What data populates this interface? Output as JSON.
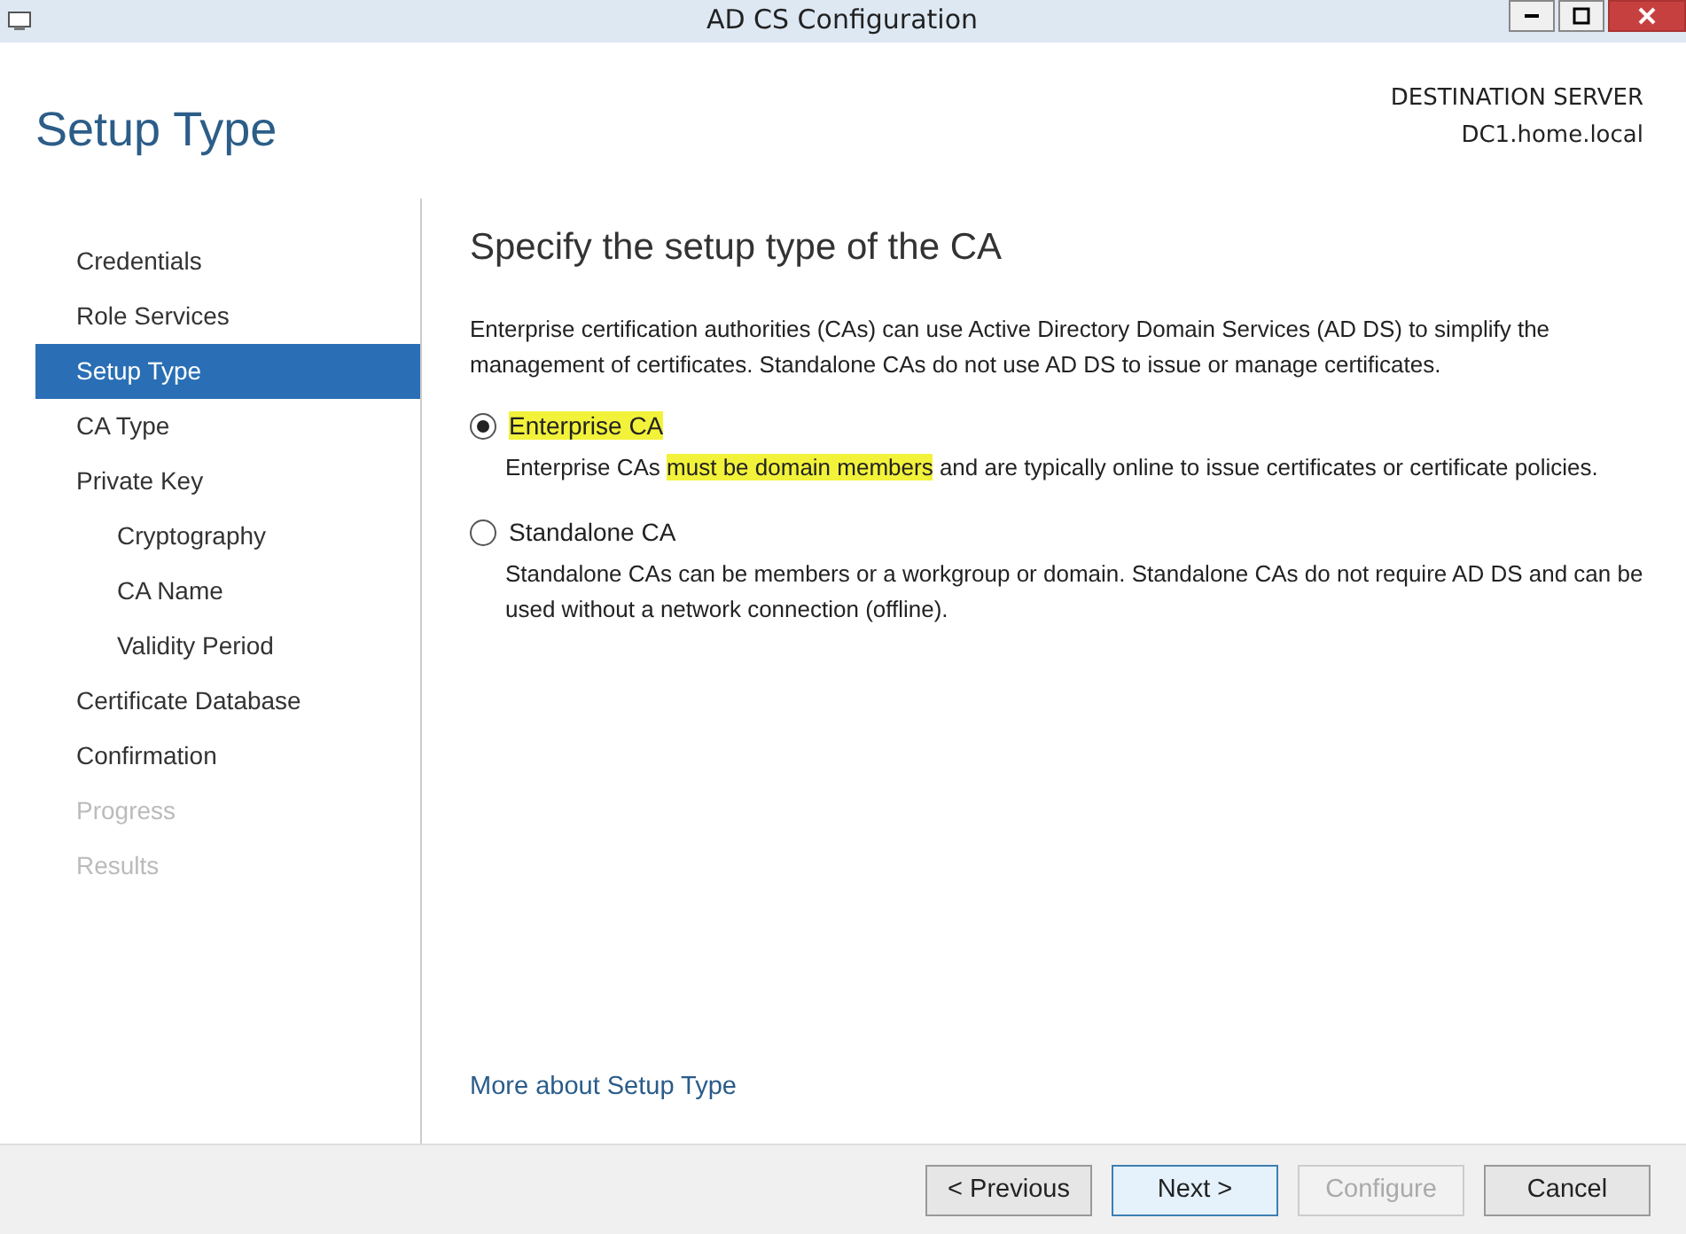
{
  "window": {
    "title": "AD CS Configuration"
  },
  "header": {
    "title": "Setup Type",
    "destination_label": "DESTINATION SERVER",
    "server": "DC1.home.local"
  },
  "sidebar": {
    "items": [
      {
        "label": "Credentials",
        "selected": false,
        "disabled": false
      },
      {
        "label": "Role Services",
        "selected": false,
        "disabled": false
      },
      {
        "label": "Setup Type",
        "selected": true,
        "disabled": false
      },
      {
        "label": "CA Type",
        "selected": false,
        "disabled": false
      },
      {
        "label": "Private Key",
        "selected": false,
        "disabled": false,
        "children": [
          {
            "label": "Cryptography",
            "selected": false,
            "disabled": false
          },
          {
            "label": "CA Name",
            "selected": false,
            "disabled": false
          },
          {
            "label": "Validity Period",
            "selected": false,
            "disabled": false
          }
        ]
      },
      {
        "label": "Certificate Database",
        "selected": false,
        "disabled": false
      },
      {
        "label": "Confirmation",
        "selected": false,
        "disabled": false
      },
      {
        "label": "Progress",
        "selected": false,
        "disabled": true
      },
      {
        "label": "Results",
        "selected": false,
        "disabled": true
      }
    ]
  },
  "content": {
    "heading": "Specify the setup type of the CA",
    "intro": "Enterprise certification authorities (CAs) can use Active Directory Domain Services (AD DS) to simplify the management of certificates. Standalone CAs do not use AD DS to issue or manage certificates.",
    "options": [
      {
        "label": "Enterprise CA",
        "selected": true,
        "highlighted": true,
        "description": [
          {
            "text": "Enterprise CAs ",
            "highlighted": false
          },
          {
            "text": "must be domain members",
            "highlighted": true
          },
          {
            "text": " and are typically online to issue certificates or certificate policies.",
            "highlighted": false
          }
        ]
      },
      {
        "label": "Standalone CA",
        "selected": false,
        "highlighted": false,
        "description": [
          {
            "text": "Standalone CAs can be members or a workgroup or domain. Standalone CAs do not require AD DS and can be used without a network connection (offline).",
            "highlighted": false
          }
        ]
      }
    ],
    "link": "More about Setup Type"
  },
  "buttons": [
    {
      "label": "< Previous",
      "disabled": false,
      "focused": false
    },
    {
      "label": "Next >",
      "disabled": false,
      "focused": true
    },
    {
      "label": "Configure",
      "disabled": true,
      "focused": false
    },
    {
      "label": "Cancel",
      "disabled": false,
      "focused": false
    }
  ]
}
